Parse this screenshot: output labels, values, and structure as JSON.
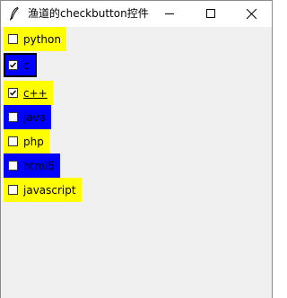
{
  "window": {
    "title": "渔道的checkbutton控件",
    "icon": "feather-icon",
    "controls": [
      "minimize-icon",
      "maximize-icon",
      "close-icon"
    ]
  },
  "colors": {
    "yellow": "#ffff00",
    "blue": "#0000ff",
    "client_bg": "#f0f0f0"
  },
  "checkbuttons": [
    {
      "label": "python",
      "checked": false,
      "bg": "#ffff00"
    },
    {
      "label": "c",
      "checked": true,
      "bg": "#0000ff"
    },
    {
      "label": "c++",
      "checked": true,
      "bg": "#ffff00"
    },
    {
      "label": "java",
      "checked": false,
      "bg": "#0000ff"
    },
    {
      "label": "php",
      "checked": false,
      "bg": "#ffff00"
    },
    {
      "label": "html5",
      "checked": false,
      "bg": "#0000ff"
    },
    {
      "label": "javascript",
      "checked": false,
      "bg": "#ffff00"
    }
  ]
}
